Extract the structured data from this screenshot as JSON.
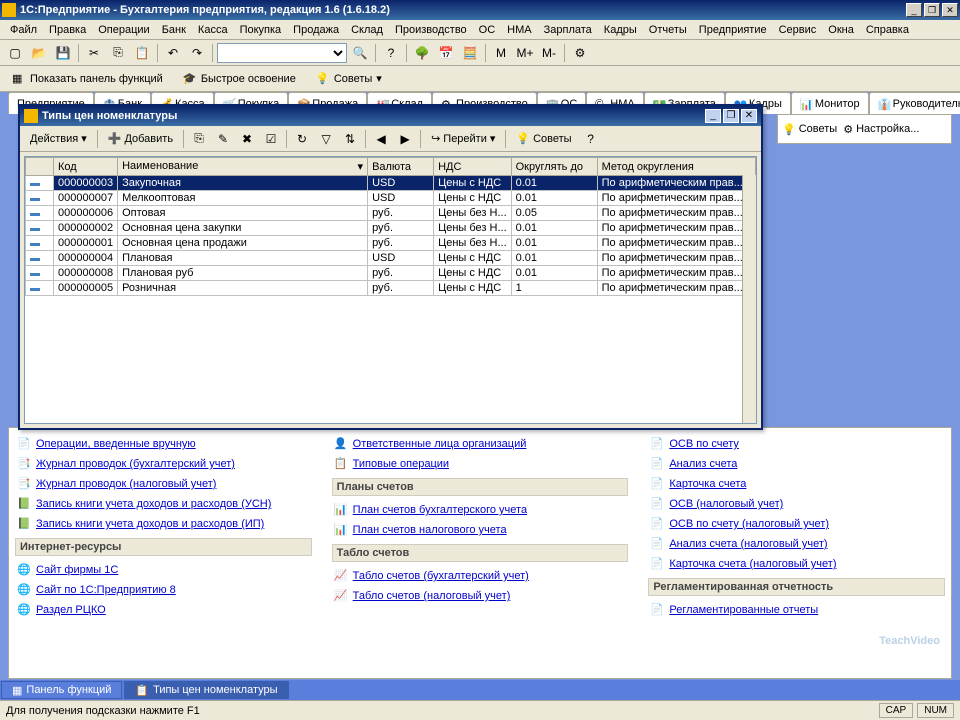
{
  "app": {
    "title": "1С:Предприятие - Бухгалтерия предприятия, редакция 1.6 (1.6.18.2)"
  },
  "menu": [
    "Файл",
    "Правка",
    "Операции",
    "Банк",
    "Касса",
    "Покупка",
    "Продажа",
    "Склад",
    "Производство",
    "ОС",
    "НМА",
    "Зарплата",
    "Кадры",
    "Отчеты",
    "Предприятие",
    "Сервис",
    "Окна",
    "Справка"
  ],
  "toolbar2": {
    "show_panel": "Показать панель функций",
    "quick_start": "Быстрое освоение",
    "tips": "Советы"
  },
  "back_tabs": [
    "Предприятие",
    "Банк",
    "Касса",
    "Покупка",
    "Продажа",
    "Склад",
    "Производство",
    "ОС",
    "НМА",
    "Зарплата",
    "Кадры"
  ],
  "right_tabs": {
    "monitor": "Монитор",
    "manager": "Руководителю"
  },
  "right_pane": {
    "tips": "Советы",
    "settings": "Настройка..."
  },
  "modal": {
    "title": "Типы цен номенклатуры",
    "actions": "Действия",
    "add": "Добавить",
    "go": "Перейти",
    "tips": "Советы",
    "columns": [
      "",
      "Код",
      "Наименование",
      "Валюта",
      "НДС",
      "Округлять до",
      "Метод округления"
    ],
    "rows": [
      {
        "code": "000000003",
        "name": "Закупочная",
        "cur": "USD",
        "vat": "Цены с НДС",
        "round": "0.01",
        "method": "По арифметическим прав..."
      },
      {
        "code": "000000007",
        "name": "Мелкооптовая",
        "cur": "USD",
        "vat": "Цены с НДС",
        "round": "0.01",
        "method": "По арифметическим прав..."
      },
      {
        "code": "000000006",
        "name": "Оптовая",
        "cur": "руб.",
        "vat": "Цены без Н...",
        "round": "0.05",
        "method": "По арифметическим прав..."
      },
      {
        "code": "000000002",
        "name": "Основная цена закупки",
        "cur": "руб.",
        "vat": "Цены без Н...",
        "round": "0.01",
        "method": "По арифметическим прав..."
      },
      {
        "code": "000000001",
        "name": "Основная цена продажи",
        "cur": "руб.",
        "vat": "Цены без Н...",
        "round": "0.01",
        "method": "По арифметическим прав..."
      },
      {
        "code": "000000004",
        "name": "Плановая",
        "cur": "USD",
        "vat": "Цены с НДС",
        "round": "0.01",
        "method": "По арифметическим прав..."
      },
      {
        "code": "000000008",
        "name": "Плановая руб",
        "cur": "руб.",
        "vat": "Цены с НДС",
        "round": "0.01",
        "method": "По арифметическим прав..."
      },
      {
        "code": "000000005",
        "name": "Розничная",
        "cur": "руб.",
        "vat": "Цены с НДС",
        "round": "1",
        "method": "По арифметическим прав..."
      }
    ]
  },
  "links_left": [
    "Операции, введенные вручную",
    "Журнал проводок (бухгалтерский учет)",
    "Журнал проводок (налоговый учет)",
    "Запись книги учета доходов и расходов (УСН)",
    "Запись книги учета доходов и расходов (ИП)"
  ],
  "section_left": "Интернет-ресурсы",
  "links_left2": [
    "Сайт фирмы 1С",
    "Сайт по 1С:Предприятию 8",
    "Раздел РЦКО"
  ],
  "links_mid_top": [
    "Ответственные лица организаций",
    "Типовые операции"
  ],
  "section_mid1": "Планы счетов",
  "links_mid1": [
    "План счетов бухгалтерского учета",
    "План счетов налогового учета"
  ],
  "section_mid2": "Табло счетов",
  "links_mid2": [
    "Табло счетов (бухгалтерский учет)",
    "Табло счетов (налоговый учет)"
  ],
  "links_right": [
    "ОСВ по счету",
    "Анализ счета",
    "Карточка счета",
    "ОСВ (налоговый учет)",
    "ОСВ по счету (налоговый учет)",
    "Анализ счета (налоговый учет)",
    "Карточка счета (налоговый учет)"
  ],
  "section_right": "Регламентированная отчетность",
  "links_right2": [
    "Регламентированные отчеты"
  ],
  "taskbar": {
    "panel": "Панель функций",
    "modal": "Типы цен номенклатуры"
  },
  "status": {
    "hint": "Для получения подсказки нажмите F1",
    "cap": "CAP",
    "num": "NUM"
  },
  "watermark": {
    "a": "Teach",
    "b": "Video"
  }
}
